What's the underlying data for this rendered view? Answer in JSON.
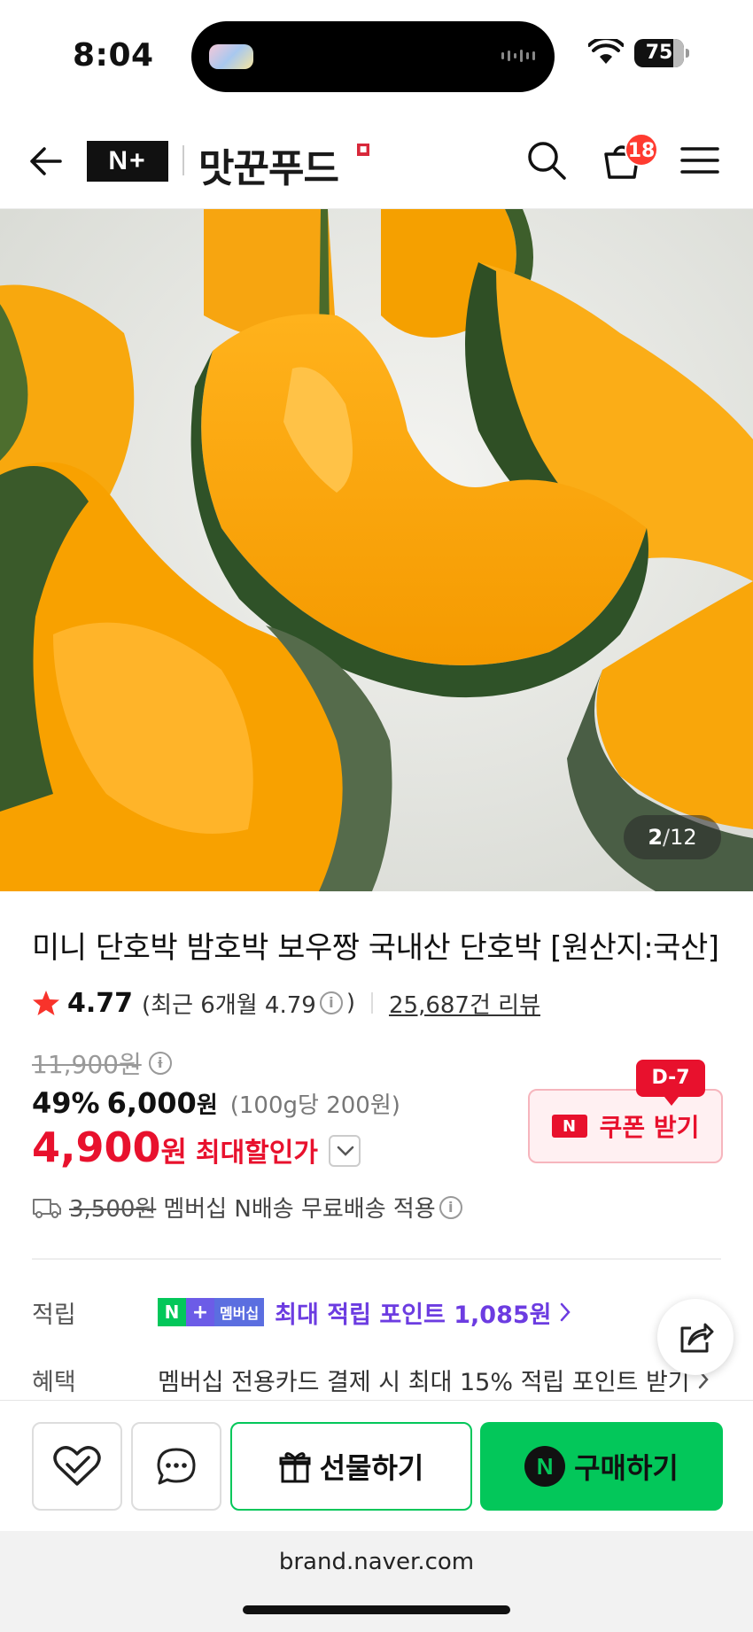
{
  "status_bar": {
    "time": "8:04",
    "battery": "75"
  },
  "header": {
    "logo_text": "N+",
    "brand_name": "맛꾼푸드",
    "cart_count": "18"
  },
  "product_image": {
    "current": "2",
    "separator": "/",
    "total": "12"
  },
  "product": {
    "title": "미니 단호박 밤호박 보우짱 국내산 단호박 [원산지:국산]",
    "rating": "4.77",
    "recent_rating_prefix": "(최근 6개월 4.79",
    "recent_rating_suffix": ")",
    "review_count": "25,687건 리뷰",
    "original_price": "11,900원",
    "discount_rate": "49%",
    "sale_price": "6,000",
    "sale_unit": "원",
    "unit_price": "(100g당 200원)",
    "max_price": "4,900",
    "max_unit": "원",
    "max_label": "최대할인가"
  },
  "coupon": {
    "dday": "D-7",
    "n_label": "N",
    "label": "쿠폰 받기"
  },
  "shipping": {
    "old_fee": "3,500원",
    "text": "멤버십 N배송 무료배송 적용"
  },
  "points": {
    "label": "적립",
    "badge_n": "N",
    "badge_plus": "+",
    "badge_text": "멤버십",
    "text": "최대 적립 포인트 1,085원"
  },
  "benefit": {
    "label": "혜택",
    "text": "멤버십 전용카드 결제 시 최대 15% 적립 포인트 받기"
  },
  "bottom_bar": {
    "gift_label": "선물하기",
    "buy_n": "N",
    "buy_label": "구매하기"
  },
  "browser": {
    "url": "brand.naver.com"
  },
  "colors": {
    "naver_green": "#03c75a",
    "sale_red": "#e8112d",
    "points_purple": "#6c3ce1"
  }
}
